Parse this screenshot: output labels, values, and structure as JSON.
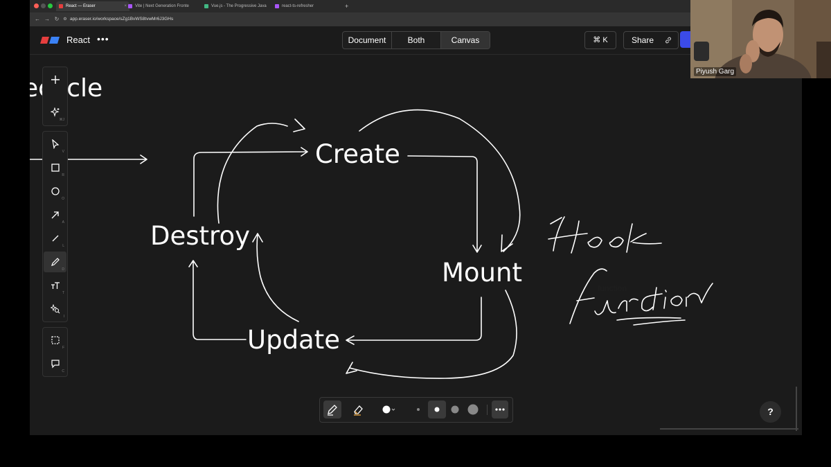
{
  "browser": {
    "tabs": [
      {
        "title": "React — Eraser",
        "active": true
      },
      {
        "title": "Vite | Next Generation Fronte"
      },
      {
        "title": "Vue.js - The Progressive Java"
      },
      {
        "title": "react-ts-refresher"
      }
    ],
    "new_tab_label": "+",
    "url": "app.eraser.io/workspace/sZg1BvWS8tvwMr6J3GHs"
  },
  "app": {
    "project_name": "React",
    "project_menu": "•••",
    "view_modes": [
      "Document",
      "Both",
      "Canvas"
    ],
    "active_view": "Canvas",
    "command_shortcut": "⌘ K",
    "share_label": "Share",
    "colors": {
      "accent": "#3b4be8",
      "logo_red": "#e53e3e",
      "logo_blue": "#3b82f6",
      "background": "#1b1b1b"
    }
  },
  "toolbar": {
    "top_group": [
      {
        "name": "add",
        "icon": "plus-icon",
        "key": ""
      },
      {
        "name": "ai",
        "icon": "sparkle-icon",
        "key": "⌘J"
      }
    ],
    "main_group": [
      {
        "name": "select",
        "icon": "cursor-icon",
        "key": "V"
      },
      {
        "name": "rectangle",
        "icon": "square-icon",
        "key": "R"
      },
      {
        "name": "ellipse",
        "icon": "circle-icon",
        "key": "O"
      },
      {
        "name": "arrow",
        "icon": "arrow-icon",
        "key": "A"
      },
      {
        "name": "line",
        "icon": "line-icon",
        "key": "L"
      },
      {
        "name": "draw",
        "icon": "pencil-icon",
        "key": "D",
        "active": true
      },
      {
        "name": "text",
        "icon": "text-icon",
        "key": "T"
      },
      {
        "name": "icon",
        "icon": "icon-search-icon",
        "key": "I"
      }
    ],
    "bottom_group": [
      {
        "name": "frame",
        "icon": "frame-icon",
        "key": "F"
      },
      {
        "name": "comment",
        "icon": "comment-icon",
        "key": "C"
      }
    ]
  },
  "canvas": {
    "title_fragment": "ecycle",
    "nodes": {
      "create": "Create",
      "mount": "Mount",
      "update": "Update",
      "destroy": "Destroy"
    },
    "handwriting": [
      "Hook",
      "function"
    ]
  },
  "pen_toolbar": {
    "tools": [
      "pen-icon",
      "eraser-icon",
      "color-picker-icon",
      "size-xs",
      "size-s",
      "size-m",
      "size-l",
      "more-icon"
    ],
    "active_tool": "pen-icon",
    "active_size": "size-s",
    "color": "#ffffff"
  },
  "help_label": "?",
  "webcam": {
    "name": "Piyush Garg"
  }
}
